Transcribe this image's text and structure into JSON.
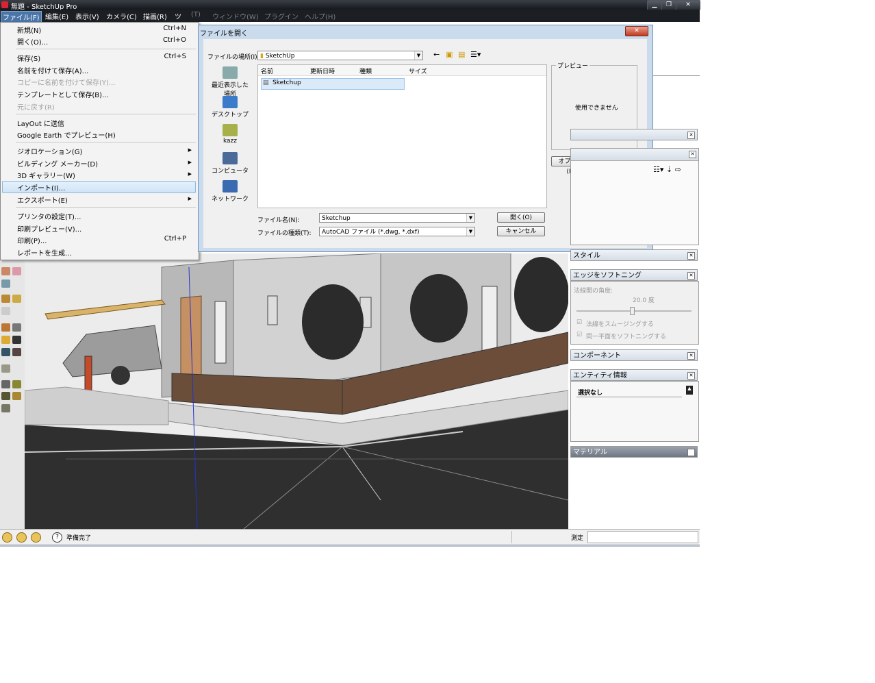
{
  "window": {
    "title": "無題 - SketchUp Pro",
    "controls": [
      "▁",
      "❐",
      "✕"
    ]
  },
  "menubar": [
    "ファイル(F)",
    "編集(E)",
    "表示(V)",
    "カメラ(C)",
    "描画(R)",
    "ツ",
    "(T)",
    "ウィンドウ(W)",
    "プラグイン",
    "ヘルプ(H)"
  ],
  "file_menu": {
    "new": "新規(N)",
    "new_short": "Ctrl+N",
    "open": "開く(O)...",
    "open_short": "Ctrl+O",
    "save": "保存(S)",
    "save_short": "Ctrl+S",
    "save_as": "名前を付けて保存(A)...",
    "save_copy": "コピーに名前を付けて保存(Y)...",
    "save_template": "テンプレートとして保存(B)...",
    "revert": "元に戻す(R)",
    "layout": "LayOut に送信",
    "google_earth": "Google Earth でプレビュー(H)",
    "geolocation": "ジオロケーション(G)",
    "building_maker": "ビルディング メーカー(D)",
    "gallery": "3D ギャラリー(W)",
    "import": "インポート(I)...",
    "export": "エクスポート(E)",
    "print_setup": "プリンタの設定(T)...",
    "print_preview": "印刷プレビュー(V)...",
    "print": "印刷(P)...",
    "print_short": "Ctrl+P",
    "report": "レポートを生成..."
  },
  "dialog": {
    "title": "ファイルを開く",
    "location_label": "ファイルの場所(I):",
    "location_value": "SketchUp",
    "columns": [
      "名前",
      "更新日時",
      "種類",
      "サイズ"
    ],
    "files": [
      "Sketchup"
    ],
    "places": [
      "最近表示した場所",
      "デスクトップ",
      "kazz",
      "コンピュータ",
      "ネットワーク"
    ],
    "preview_label": "プレビュー",
    "preview_text": "使用できません",
    "options_button": "オプション(P)...",
    "filename_label": "ファイル名(N):",
    "filename_value": "Sketchup",
    "filetype_label": "ファイルの種類(T):",
    "filetype_value": "AutoCAD ファイル (*.dwg, *.dxf)",
    "open_button": "開く(O)",
    "cancel_button": "キャンセル"
  },
  "trays": {
    "styles": "スタイル",
    "soften": "エッジをソフトニング",
    "angle_label": "法線間の角度:",
    "angle_value": "20.0 度",
    "smooth_check": "法線をスムージングする",
    "coplanar_check": "同一平面をソフトニングする",
    "components": "コンポーネント",
    "entity": "エンティティ情報",
    "entity_value": "選択なし",
    "materials": "マテリアル"
  },
  "statusbar": {
    "status": "準備完了",
    "measure_label": "測定"
  }
}
